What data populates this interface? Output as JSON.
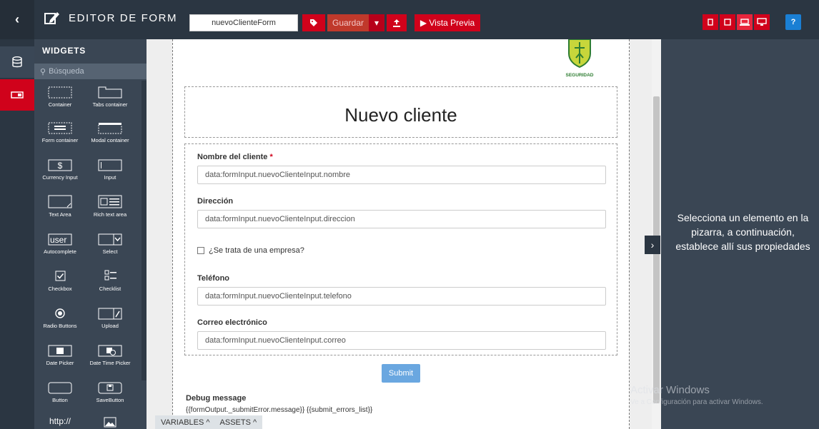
{
  "toolbar": {
    "title": "EDITOR DE FORM",
    "form_name": "nuevoClienteForm",
    "save_label": "Guardar",
    "preview_label": "▶ Vista Previa",
    "help_label": "?"
  },
  "widgets_panel": {
    "title": "WIDGETS",
    "search_placeholder": "Búsqueda",
    "items": [
      {
        "label": "Container",
        "icon": "container-icon"
      },
      {
        "label": "Tabs container",
        "icon": "tabs-container-icon"
      },
      {
        "label": "Form container",
        "icon": "form-container-icon"
      },
      {
        "label": "Modal container",
        "icon": "modal-container-icon"
      },
      {
        "label": "Currency Input",
        "icon": "currency-input-icon"
      },
      {
        "label": "Input",
        "icon": "input-icon"
      },
      {
        "label": "Text Area",
        "icon": "text-area-icon"
      },
      {
        "label": "Rich text area",
        "icon": "rich-text-area-icon"
      },
      {
        "label": "Autocomplete",
        "icon": "autocomplete-icon",
        "icon_text": "user"
      },
      {
        "label": "Select",
        "icon": "select-icon"
      },
      {
        "label": "Checkbox",
        "icon": "checkbox-icon"
      },
      {
        "label": "Checklist",
        "icon": "checklist-icon"
      },
      {
        "label": "Radio Buttons",
        "icon": "radio-buttons-icon"
      },
      {
        "label": "Upload",
        "icon": "upload-icon"
      },
      {
        "label": "Date Picker",
        "icon": "date-picker-icon"
      },
      {
        "label": "Date Time Picker",
        "icon": "date-time-picker-icon"
      },
      {
        "label": "Button",
        "icon": "button-icon"
      },
      {
        "label": "SaveButton",
        "icon": "save-button-icon"
      },
      {
        "label": "",
        "icon": "link-icon",
        "icon_text": "http://"
      },
      {
        "label": "",
        "icon": "image-icon"
      }
    ]
  },
  "form": {
    "logo_text": "SEGURIDAD",
    "title": "Nuevo cliente",
    "fields": [
      {
        "label": "Nombre del cliente",
        "required_mark": "*",
        "value": "data:formInput.nuevoClienteInput.nombre"
      },
      {
        "label": "Dirección",
        "value": "data:formInput.nuevoClienteInput.direccion"
      },
      {
        "label": "Teléfono",
        "value": "data:formInput.nuevoClienteInput.telefono"
      },
      {
        "label": "Correo electrónico",
        "value": "data:formInput.nuevoClienteInput.correo"
      }
    ],
    "company_checkbox_label": "¿Se trata de una empresa?",
    "submit_label": "Submit",
    "debug_title": "Debug message",
    "debug_expression": "{{formOutput._submitError.message}} {{submit_errors_list}}"
  },
  "bottom_tabs": {
    "variables": "VARIABLES ^",
    "assets": "ASSETS ^"
  },
  "properties_panel": {
    "message": "Selecciona un elemento en la pizarra, a continuación, establece allí sus propiedades"
  },
  "watermark": {
    "title": "Activar Windows",
    "subtitle": "Ve a Configuración para activar Windows."
  },
  "colors": {
    "accent": "#d0021b",
    "dark": "#2b3642",
    "panel": "#3a4654",
    "submit": "#6aa7e0",
    "help": "#1a7fd4"
  }
}
